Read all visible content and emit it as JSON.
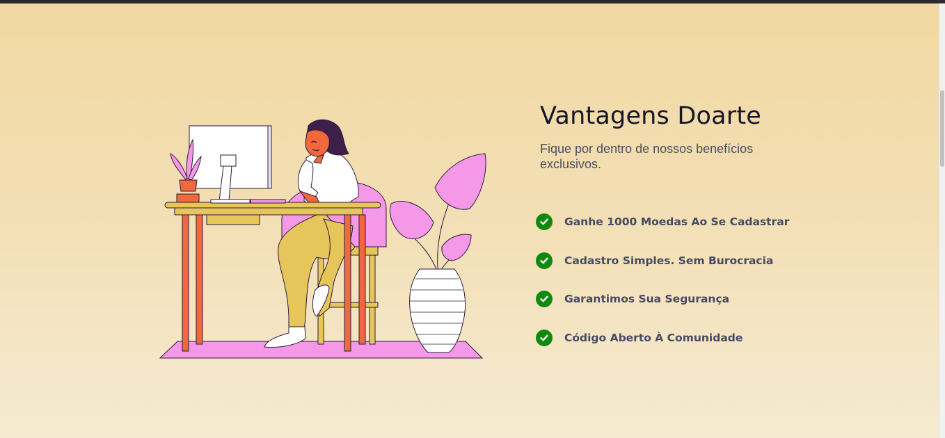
{
  "section": {
    "title": "Vantagens Doarte",
    "subtitle": "Fique por dentro de nossos benefícios exclusivos.",
    "benefits": [
      {
        "label": "Ganhe 1000 Moedas Ao Se Cadastrar",
        "icon": "check-circle-icon"
      },
      {
        "label": "Cadastro Simples. Sem Burocracia",
        "icon": "check-circle-icon"
      },
      {
        "label": "Garantimos Sua Segurança",
        "icon": "check-circle-icon"
      },
      {
        "label": "Código Aberto À Comunidade",
        "icon": "check-circle-icon"
      }
    ]
  },
  "colors": {
    "check": "#0f8a0f",
    "title": "#161629",
    "text": "#464a63",
    "background_top": "#f2d8a1",
    "background_bottom": "#f5ead0",
    "accent_pink": "#f598e8",
    "accent_orange": "#f2683d",
    "accent_mustard": "#e6c65a"
  }
}
